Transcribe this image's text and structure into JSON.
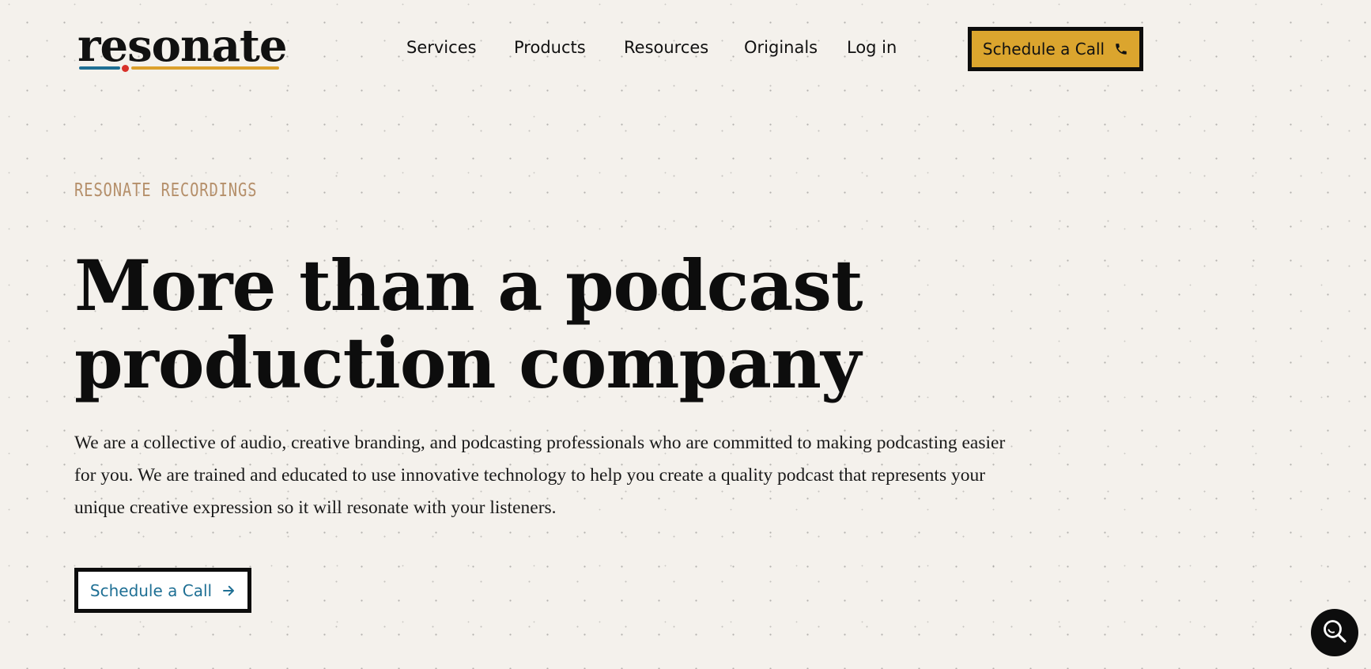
{
  "header": {
    "logo_text": "resonate",
    "nav": [
      {
        "label": "Services"
      },
      {
        "label": "Products"
      },
      {
        "label": "Resources"
      },
      {
        "label": "Originals"
      },
      {
        "label": "Log in"
      }
    ],
    "cta_label": "Schedule a Call",
    "cta_icon": "phone-icon"
  },
  "hero": {
    "eyebrow": "RESONATE RECORDINGS",
    "title_line1": "More than a podcast",
    "title_line2": "production company",
    "body": "We are a collective of audio, creative branding, and podcasting professionals who are committed to making podcasting easier for you. We are trained and educated to use innovative technology to help you create a quality podcast that represents your unique creative expression so it will resonate with your listeners.",
    "cta_label": "Schedule a Call",
    "cta_icon": "arrow-right-icon"
  },
  "search_fab": {
    "icon": "search-icon"
  },
  "colors": {
    "background": "#f4f1ec",
    "gold": "#dba52e",
    "blue": "#1e6f94",
    "red": "#d8312a",
    "eyebrow": "#b58f6a",
    "ink": "#0d0d0d"
  }
}
